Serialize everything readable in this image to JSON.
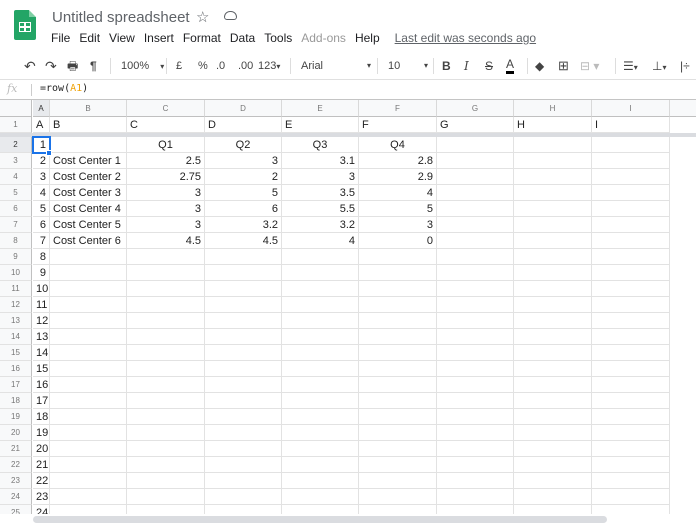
{
  "app": {
    "title": "Untitled spreadsheet",
    "menu": [
      "File",
      "Edit",
      "View",
      "Insert",
      "Format",
      "Data",
      "Tools",
      "Add-ons",
      "Help"
    ],
    "disabled_menu": [
      "Add-ons"
    ],
    "last_edit": "Last edit was seconds ago"
  },
  "toolbar": {
    "zoom": "100%",
    "currency": "£",
    "percent": "%",
    "decrease_decimal": ".0",
    "increase_decimal": ".00",
    "more_formats": "123",
    "font": "Arial",
    "font_size": "10",
    "bold": "B",
    "italic": "I",
    "strike": "S",
    "text_color": "A",
    "text_color_value": "#000000"
  },
  "formula_bar": {
    "fx": "fx",
    "prefix": "=row(",
    "ref": "A1",
    "suffix": ")",
    "ref_color": "#f0a30a"
  },
  "grid": {
    "column_headers": [
      "A",
      "B",
      "C",
      "D",
      "E",
      "F",
      "G",
      "H",
      "I"
    ],
    "selected_column": "A",
    "selected_row": 2,
    "row_headers": [
      "1",
      "2",
      "3",
      "4",
      "5",
      "6",
      "7",
      "8",
      "9",
      "10",
      "11",
      "12",
      "13",
      "14",
      "15",
      "16",
      "17",
      "18",
      "19",
      "20",
      "21",
      "22",
      "23",
      "24",
      "25"
    ],
    "frozen_rows": 1,
    "row1": [
      "A",
      "B",
      "C",
      "D",
      "E",
      "F",
      "G",
      "H",
      "I"
    ],
    "col_a_values": [
      "1",
      "2",
      "3",
      "4",
      "5",
      "6",
      "7",
      "8",
      "9",
      "10",
      "11",
      "12",
      "13",
      "14",
      "15",
      "16",
      "17",
      "18",
      "19",
      "20",
      "21",
      "22",
      "23",
      "24"
    ],
    "quarter_headers": [
      "Q1",
      "Q2",
      "Q3",
      "Q4"
    ],
    "data_rows": [
      {
        "name": "Cost Center 1",
        "values": [
          "2.5",
          "3",
          "3.1",
          "2.8"
        ]
      },
      {
        "name": "Cost Center 2",
        "values": [
          "2.75",
          "2",
          "3",
          "2.9"
        ]
      },
      {
        "name": "Cost Center 3",
        "values": [
          "3",
          "5",
          "3.5",
          "4"
        ]
      },
      {
        "name": "Cost Center 4",
        "values": [
          "3",
          "6",
          "5.5",
          "5"
        ]
      },
      {
        "name": "Cost Center 5",
        "values": [
          "3",
          "3.2",
          "3.2",
          "3"
        ]
      },
      {
        "name": "Cost Center 6",
        "values": [
          "4.5",
          "4.5",
          "4",
          "0"
        ]
      }
    ]
  }
}
